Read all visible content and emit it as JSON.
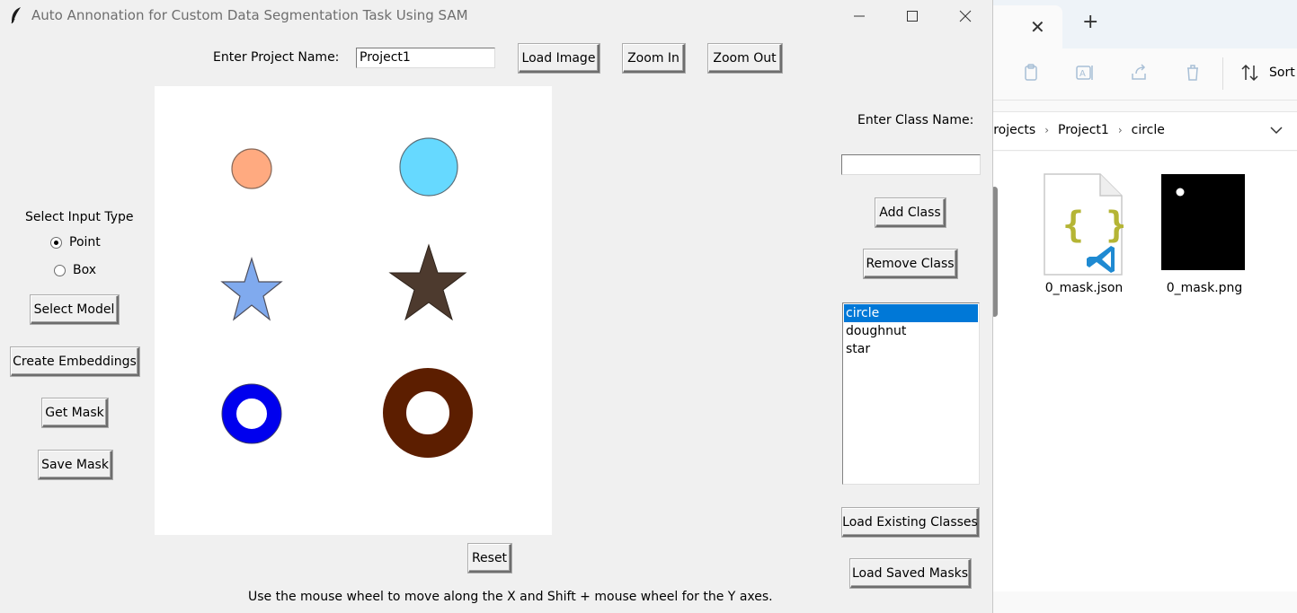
{
  "window": {
    "title": "Auto Annonation for Custom Data Segmentation Task Using SAM"
  },
  "top": {
    "project_label": "Enter Project Name:",
    "project_value": "Project1",
    "load_image": "Load Image",
    "zoom_in": "Zoom In",
    "zoom_out": "Zoom Out"
  },
  "left": {
    "input_type_label": "Select Input Type",
    "radio_point": "Point",
    "radio_box": "Box",
    "selected_input": "Point",
    "select_model": "Select Model",
    "create_embeddings": "Create Embeddings",
    "get_mask": "Get Mask",
    "save_mask": "Save Mask"
  },
  "canvas": {
    "shapes": [
      {
        "kind": "circle",
        "color": "#ffaa80"
      },
      {
        "kind": "circle",
        "color": "#66d9ff"
      },
      {
        "kind": "star",
        "color": "#80aaee"
      },
      {
        "kind": "star",
        "color": "#4d3a2e"
      },
      {
        "kind": "doughnut",
        "color": "#0000ee"
      },
      {
        "kind": "doughnut",
        "color": "#5c1e00"
      }
    ]
  },
  "bottom": {
    "reset": "Reset",
    "hint": "Use the mouse wheel to move along the X and Shift + mouse wheel for the Y axes."
  },
  "right": {
    "class_label": "Enter Class Name:",
    "class_value": "",
    "add_class": "Add Class",
    "remove_class": "Remove Class",
    "classes": [
      "circle",
      "doughnut",
      "star"
    ],
    "selected_class": "circle",
    "load_existing": "Load Existing Classes",
    "load_saved": "Load Saved Masks"
  },
  "explorer": {
    "sort_label": "Sort",
    "breadcrumb": [
      "Projects",
      "Project1",
      "circle"
    ],
    "files": [
      {
        "name": "0_mask.json",
        "icon": "vscode-json-file-icon"
      },
      {
        "name": "0_mask.png",
        "icon": "mask-image-thumbnail"
      }
    ],
    "colors": {
      "accent": "#0078d7",
      "vscode": "#1f8ad2",
      "json_braces": "#b5b535"
    }
  }
}
